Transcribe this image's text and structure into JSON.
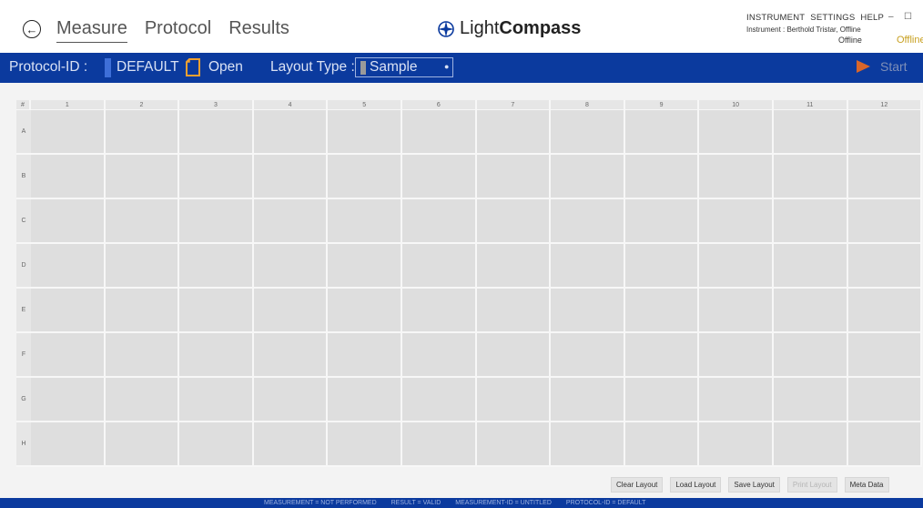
{
  "header": {
    "tabs": [
      {
        "label": "Measure"
      },
      {
        "label": "Protocol"
      },
      {
        "label": "Results"
      }
    ],
    "logo": {
      "light": "Light",
      "bold": "Compass"
    },
    "menu": {
      "instrument": "INSTRUMENT",
      "settings": "SETTINGS",
      "help": "HELP"
    },
    "instrument_status": "Instrument : Berthold Tristar, Offline",
    "offline_small": "Offline",
    "offline_accent": "Offline",
    "window_controls": {
      "minimize": "–",
      "maximize": "☐"
    }
  },
  "toolbar": {
    "protocol_id_label": "Protocol-ID :",
    "protocol_id_value": "DEFAULT",
    "open_label": "Open",
    "layout_type_label": "Layout Type :",
    "layout_type_value": "Sample",
    "start_label": "Start"
  },
  "plate": {
    "corner": "#",
    "columns": [
      "1",
      "2",
      "3",
      "4",
      "5",
      "6",
      "7",
      "8",
      "9",
      "10",
      "11",
      "12"
    ],
    "rows": [
      "A",
      "B",
      "C",
      "D",
      "E",
      "F",
      "G",
      "H"
    ]
  },
  "buttons": {
    "clear_layout": "Clear Layout",
    "load_layout": "Load Layout",
    "save_layout": "Save Layout",
    "print_layout": "Print Layout",
    "meta_data": "Meta Data"
  },
  "statusbar": {
    "measurement": "MEASUREMENT = NOT PERFORMED",
    "result": "RESULT = VALID",
    "measurement_id": "MEASUREMENT-ID = UNTITLED",
    "protocol_id": "PROTOCOL-ID = DEFAULT"
  },
  "colors": {
    "toolbar_blue": "#0b3a9e",
    "well_gray": "#dedede",
    "offline_accent": "#c8a020",
    "protocol_marker": "#3e6fd8"
  }
}
